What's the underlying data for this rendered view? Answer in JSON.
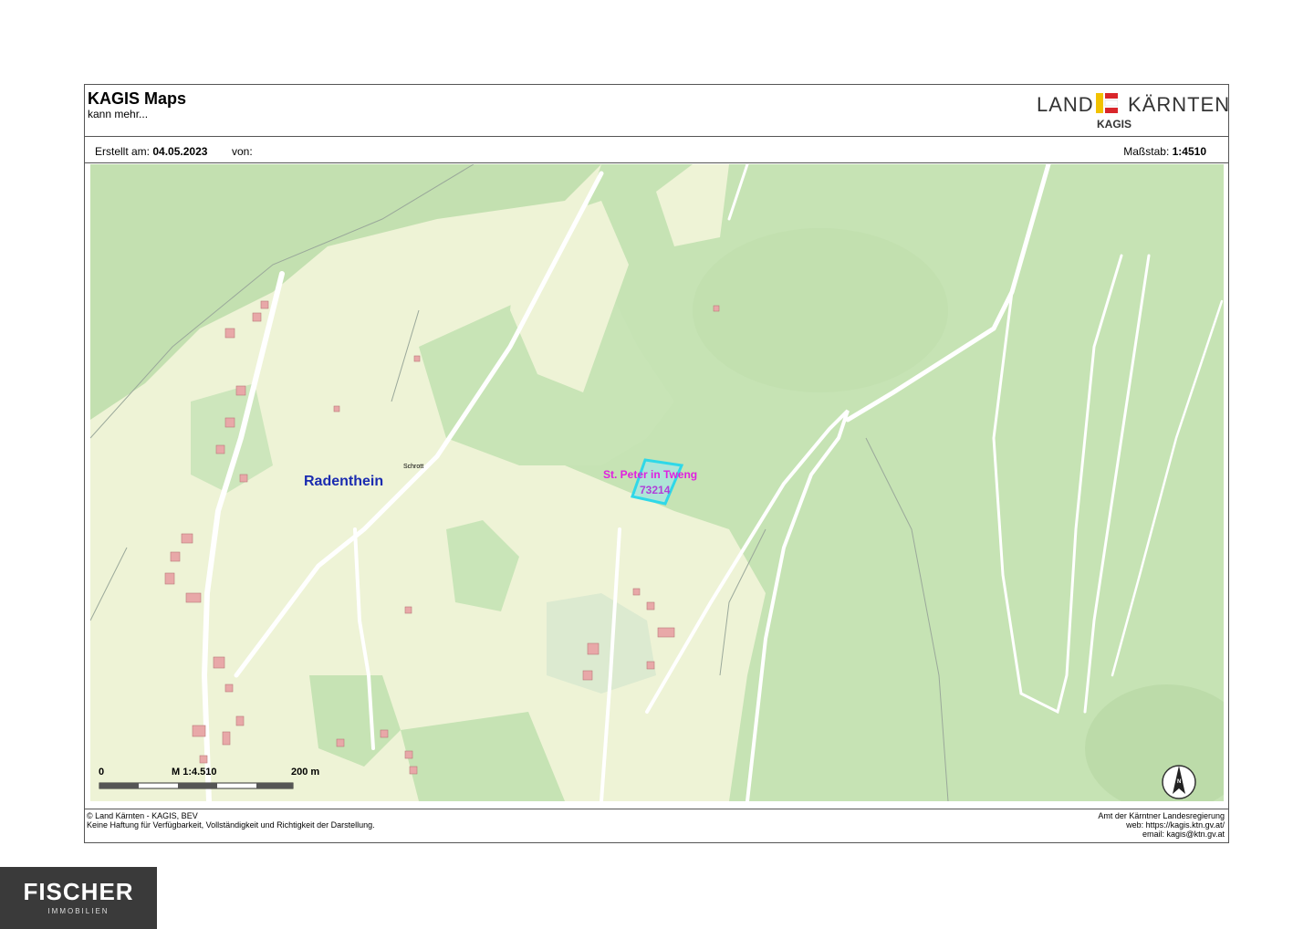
{
  "header": {
    "title": "KAGIS Maps",
    "subtitle": "kann mehr...",
    "logo_land": "LAND",
    "logo_kaernten": "KÄRNTEN",
    "logo_kagis": "KAGIS"
  },
  "info": {
    "created_label": "Erstellt am:",
    "created_date": "04.05.2023",
    "by_label": "von:",
    "scale_label": "Maßstab:",
    "scale_value": "1:4510"
  },
  "map": {
    "place_name": "Radenthein",
    "parcel_name": "St. Peter in Tweng",
    "parcel_id": "73214",
    "road_label_schrott": "Schrott",
    "scalebar_zero": "0",
    "scalebar_ratio": "M 1:4.510",
    "scalebar_distance": "200 m",
    "north_label": "N",
    "colors": {
      "forest": "#c6e3b4",
      "meadow": "#eef3d6",
      "parcel": "#2fd8e8",
      "parcel_label": "#e020e0",
      "place_label": "#1a2bb0",
      "building": "#e8a8a8"
    }
  },
  "footer": {
    "left_line1": "© Land Kärnten - KAGIS, BEV",
    "left_line2": "Keine Haftung für Verfügbarkeit, Vollständigkeit und Richtigkeit der Darstellung.",
    "right_line1": "Amt der Kärntner Landesregierung",
    "right_line2": "web: https://kagis.ktn.gv.at/",
    "right_line3": "email: kagis@ktn.gv.at"
  },
  "brand": {
    "name": "FISCHER",
    "sub": "IMMOBILIEN"
  }
}
